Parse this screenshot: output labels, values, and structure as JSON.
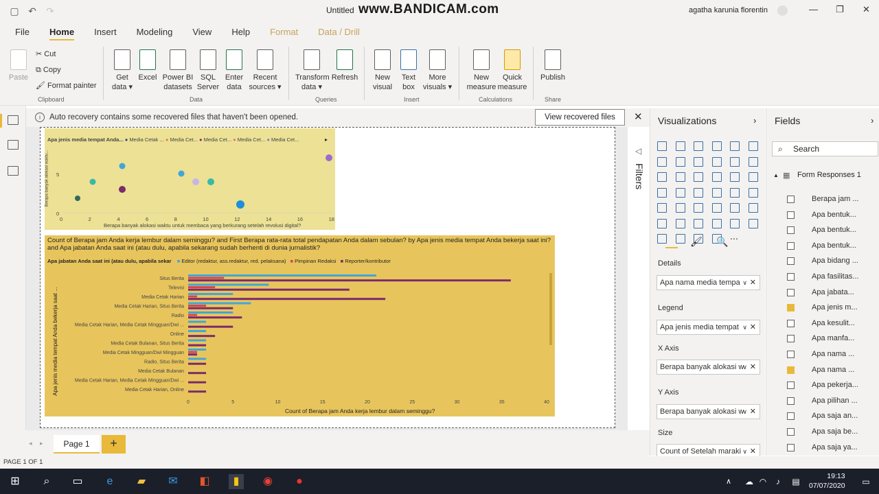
{
  "window": {
    "doc_title": "Untitled",
    "watermark": "www.BANDICAM.com",
    "user": "agatha karunia florentin",
    "min": "—",
    "max": "❐",
    "close": "✕"
  },
  "menu": [
    "File",
    "Home",
    "Insert",
    "Modeling",
    "View",
    "Help",
    "Format",
    "Data / Drill"
  ],
  "ribbon": {
    "paste": "Paste",
    "cut": "Cut",
    "copy": "Copy",
    "format_painter": "Format painter",
    "get_data": "Get data",
    "excel": "Excel",
    "powerbi": "Power BI datasets",
    "sql": "SQL Server",
    "enter": "Enter data",
    "recent": "Recent sources",
    "transform": "Transform data",
    "refresh": "Refresh",
    "new_visual": "New visual",
    "text_box": "Text box",
    "more_visuals": "More visuals",
    "new_measure": "New measure",
    "quick_measure": "Quick measure",
    "publish": "Publish",
    "groups": {
      "clipboard": "Clipboard",
      "data": "Data",
      "queries": "Queries",
      "insert": "Insert",
      "calculations": "Calculations",
      "share": "Share"
    }
  },
  "infobar": {
    "message": "Auto recovery contains some recovered files that haven't been opened.",
    "button": "View recovered files"
  },
  "visual1": {
    "legend_title": "Apa jenis media tempat Anda...",
    "legend_items": [
      {
        "name": "Media Cetak ...",
        "color": "#2e3c8c"
      },
      {
        "name": "Media Cet...",
        "color": "#e8774a"
      },
      {
        "name": "Media Cet...",
        "color": "#7b2a6b"
      },
      {
        "name": "Media Cet...",
        "color": "#e66c8a"
      },
      {
        "name": "Media Cet...",
        "color": "#9b6bd0"
      }
    ],
    "xlabel": "Berapa banyak alokasi waktu untuk membaca yang berkurang setelah revolusi digital?",
    "ylabel": "Berapa banyak alokasi waktu...",
    "xticks": [
      "0",
      "2",
      "4",
      "6",
      "8",
      "10",
      "12",
      "14",
      "16",
      "18"
    ],
    "yticks": [
      "0",
      "5"
    ]
  },
  "chart_data": {
    "type": "bar",
    "title": "Count of Berapa jam Anda kerja lembur dalam seminggu? and First Berapa rata-rata total pendapatan Anda dalam sebulan? by Apa jenis media tempat Anda bekerja saat ini? and Apa jabatan Anda saat ini (atau dulu, apabila sekarang sudah berhenti di dunia jurnalistik?",
    "legend_title": "Apa jabatan Anda saat ini (atau dulu, apabila sekar",
    "xlabel": "Count of Berapa jam Anda kerja lembur dalam seminggu?",
    "ylabel": "Apa jenis media tempat Anda bekerja saat ...",
    "xlim": [
      0,
      40
    ],
    "xticks": [
      "0",
      "5",
      "10",
      "15",
      "20",
      "25",
      "30",
      "35",
      "40"
    ],
    "categories": [
      "Situs Berita",
      "Televisi",
      "Media Cetak Harian",
      "Media Cetak Harian, Situs Berita",
      "Radio",
      "Media Cetak Harian, Media Cetak Mingguan/Dwi ...",
      "Online",
      "Media Cetak Bulanan, Situs Berita",
      "Media Cetak Mingguan/Dwi Mingguan",
      "Radio, Situs Berita",
      "Media Cetak Bulanan",
      "Media Cetak Harian, Media Cetak Mingguan/Dwi ...",
      "Media Cetak Harian, Online"
    ],
    "series": [
      {
        "name": "Editor (redaktur, ass.redaktur, red. pelaksana)",
        "color": "#41a6d9",
        "values": [
          21,
          9,
          5,
          7,
          5,
          2,
          2,
          2,
          2,
          2,
          0,
          0,
          0
        ]
      },
      {
        "name": "Pimpinan Redaksi",
        "color": "#d64550",
        "values": [
          4,
          3,
          1,
          2,
          1,
          0,
          0,
          0,
          1,
          0,
          0,
          0,
          0
        ]
      },
      {
        "name": "Reporter/kontributor",
        "color": "#7b2a6b",
        "values": [
          36,
          18,
          22,
          5,
          6,
          5,
          3,
          2,
          1,
          2,
          2,
          2,
          2
        ]
      }
    ]
  },
  "filters": "Filters",
  "visualizations": {
    "title": "Visualizations",
    "details": "Details",
    "details_field": "Apa nama media tempa",
    "legend": "Legend",
    "legend_field": "Apa jenis media tempat",
    "xaxis": "X Axis",
    "xaxis_field": "Berapa banyak alokasi w",
    "yaxis": "Y Axis",
    "yaxis_field": "Berapa banyak alokasi w",
    "size": "Size",
    "size_field": "Count of Setelah maraki"
  },
  "fields": {
    "title": "Fields",
    "search": "Search",
    "table": "Form Responses 1",
    "items": [
      {
        "label": "Berapa jam ...",
        "checked": false,
        "nocb": true
      },
      {
        "label": "Apa bentuk...",
        "checked": false
      },
      {
        "label": "Apa bentuk...",
        "checked": false
      },
      {
        "label": "Apa bentuk...",
        "checked": false
      },
      {
        "label": "Apa bidang ...",
        "checked": false
      },
      {
        "label": "Apa fasilitas...",
        "checked": false
      },
      {
        "label": "Apa jabata...",
        "checked": false
      },
      {
        "label": "Apa jenis m...",
        "checked": true
      },
      {
        "label": "Apa kesulit...",
        "checked": false
      },
      {
        "label": "Apa manfa...",
        "checked": false
      },
      {
        "label": "Apa nama ...",
        "checked": false
      },
      {
        "label": "Apa nama ...",
        "checked": true
      },
      {
        "label": "Apa pekerja...",
        "checked": false
      },
      {
        "label": "Apa pilihan ...",
        "checked": false
      },
      {
        "label": "Apa saja an...",
        "checked": false
      },
      {
        "label": "Apa saja be...",
        "checked": false
      },
      {
        "label": "Apa saja ya...",
        "checked": false
      }
    ]
  },
  "pages": {
    "tab": "Page 1",
    "add": "+"
  },
  "status": "PAGE 1 OF 1",
  "clock": {
    "time": "19:13",
    "date": "07/07/2020"
  }
}
